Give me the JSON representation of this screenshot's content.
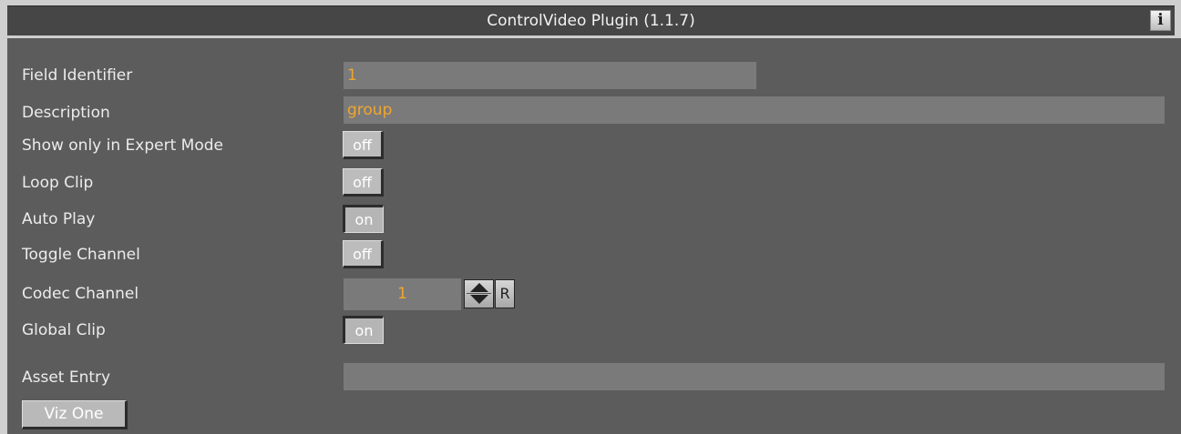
{
  "panel": {
    "title": "ControlVideo Plugin (1.1.7)",
    "info_icon": "i"
  },
  "fields": {
    "field_identifier": {
      "label": "Field Identifier",
      "value": "1"
    },
    "description": {
      "label": "Description",
      "value": "group"
    },
    "expert_mode": {
      "label": "Show only in Expert Mode",
      "state": "off"
    },
    "loop_clip": {
      "label": "Loop Clip",
      "state": "off"
    },
    "auto_play": {
      "label": "Auto Play",
      "state": "on"
    },
    "toggle_channel": {
      "label": "Toggle Channel",
      "state": "off"
    },
    "codec_channel": {
      "label": "Codec Channel",
      "value": "1",
      "reset_label": "R"
    },
    "global_clip": {
      "label": "Global Clip",
      "state": "on"
    },
    "asset_entry": {
      "label": "Asset Entry",
      "value": ""
    }
  },
  "buttons": {
    "viz_one": "Viz One"
  },
  "colors": {
    "panel_bg": "#5c5c5c",
    "field_bg": "#7a7a7a",
    "value_text": "#f0a630",
    "label_text": "#ececec"
  }
}
